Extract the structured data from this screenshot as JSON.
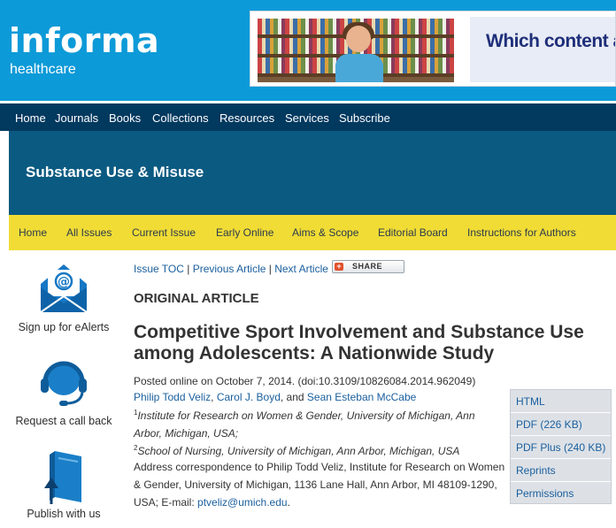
{
  "header": {
    "logo_main": "informa",
    "logo_sub": "healthcare",
    "banner_text": "Which content acc"
  },
  "main_nav": [
    "Home",
    "Journals",
    "Books",
    "Collections",
    "Resources",
    "Services",
    "Subscribe"
  ],
  "journal": {
    "title": "Substance Use & Misuse"
  },
  "sub_nav": [
    "Home",
    "All Issues",
    "Current Issue",
    "Early Online",
    "Aims & Scope",
    "Editorial Board",
    "Instructions for Authors"
  ],
  "sidebar": {
    "ealerts_label": "Sign up for eAlerts",
    "callback_label": "Request a call back",
    "publish_label": "Publish with us"
  },
  "article_links": {
    "issue_toc": "Issue TOC",
    "separator": " | ",
    "previous": "Previous Article",
    "next": "Next Article",
    "share": "SHARE",
    "share_plus": "+"
  },
  "article": {
    "type": "ORIGINAL ARTICLE",
    "title": "Competitive Sport Involvement and Substance Use among Adolescents: A Nationwide Study",
    "posted": "Posted online on October 7, 2014. (doi:10.3109/10826084.2014.962049)",
    "authors": [
      "Philip Todd Veliz",
      "Carol J. Boyd",
      "Sean Esteban McCabe"
    ],
    "author_sep1": ", ",
    "author_sep2": ", and ",
    "affil1_num": "1",
    "affil1": "Institute for Research on Women & Gender, University of Michigan, Ann Arbor, Michigan, USA;",
    "affil2_num": "2",
    "affil2": "School of Nursing, University of Michigan, Ann Arbor, Michigan, USA",
    "correspondence": "Address correspondence to Philip Todd Veliz, Institute for Research on Women & Gender, University of Michigan, 1136 Lane Hall, Ann Arbor, MI 48109-1290, USA; E-mail: ",
    "email": "ptveliz@umich.edu",
    "email_end": "."
  },
  "formats": [
    "HTML",
    "PDF (226 KB)",
    "PDF Plus (240 KB)",
    "Reprints",
    "Permissions"
  ],
  "colors": {
    "header_blue": "#0d9ad8",
    "nav_navy": "#01395f",
    "journal_band": "#0b5a81",
    "subnav_yellow": "#f1dc35",
    "link_blue": "#1a5f9e"
  }
}
